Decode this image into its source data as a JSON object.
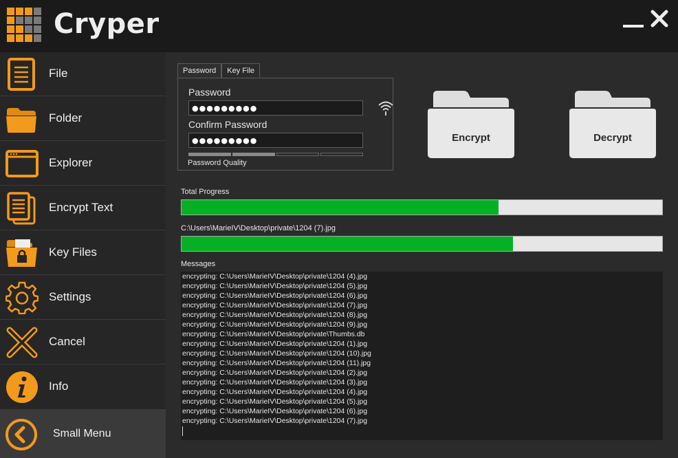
{
  "app": {
    "title": "Cryper"
  },
  "sidebar": {
    "items": [
      {
        "label": "File",
        "icon": "file-icon"
      },
      {
        "label": "Folder",
        "icon": "folder-icon"
      },
      {
        "label": "Explorer",
        "icon": "explorer-window-icon"
      },
      {
        "label": "Encrypt Text",
        "icon": "documents-icon"
      },
      {
        "label": "Key Files",
        "icon": "key-files-icon"
      },
      {
        "label": "Settings",
        "icon": "gear-icon"
      },
      {
        "label": "Cancel",
        "icon": "cancel-x-icon"
      },
      {
        "label": "Info",
        "icon": "info-icon"
      }
    ],
    "small_menu_label": "Small Menu"
  },
  "password_panel": {
    "tabs": [
      "Password",
      "Key File"
    ],
    "password_label": "Password",
    "password_value": "●●●●●●●●●",
    "confirm_label": "Confirm Password",
    "confirm_value": "●●●●●●●●●",
    "quality_label": "Password Quality",
    "quality_level": 0.5
  },
  "actions": {
    "encrypt_label": "Encrypt",
    "decrypt_label": "Decrypt"
  },
  "progress": {
    "total_label": "Total Progress",
    "total_percent": 66,
    "file_label": "C:\\Users\\MarieIV\\Desktop\\private\\1204 (7).jpg",
    "file_percent": 69
  },
  "messages": {
    "label": "Messages",
    "lines": [
      "encrypting: C:\\Users\\MarieIV\\Desktop\\private\\1204 (4).jpg",
      "encrypting: C:\\Users\\MarieIV\\Desktop\\private\\1204 (5).jpg",
      "encrypting: C:\\Users\\MarieIV\\Desktop\\private\\1204 (6).jpg",
      "encrypting: C:\\Users\\MarieIV\\Desktop\\private\\1204 (7).jpg",
      "encrypting: C:\\Users\\MarieIV\\Desktop\\private\\1204 (8).jpg",
      "encrypting: C:\\Users\\MarieIV\\Desktop\\private\\1204 (9).jpg",
      "encrypting: C:\\Users\\MarieIV\\Desktop\\private\\Thumbs.db",
      "encrypting: C:\\Users\\MarieIV\\Desktop\\private\\1204 (1).jpg",
      "encrypting: C:\\Users\\MarieIV\\Desktop\\private\\1204 (10).jpg",
      "encrypting: C:\\Users\\MarieIV\\Desktop\\private\\1204 (11).jpg",
      "encrypting: C:\\Users\\MarieIV\\Desktop\\private\\1204 (2).jpg",
      "encrypting: C:\\Users\\MarieIV\\Desktop\\private\\1204 (3).jpg",
      "encrypting: C:\\Users\\MarieIV\\Desktop\\private\\1204 (4).jpg",
      "encrypting: C:\\Users\\MarieIV\\Desktop\\private\\1204 (5).jpg",
      "encrypting: C:\\Users\\MarieIV\\Desktop\\private\\1204 (6).jpg",
      "encrypting: C:\\Users\\MarieIV\\Desktop\\private\\1204 (7).jpg"
    ]
  },
  "colors": {
    "accent": "#f29a1b",
    "progress_fill": "#06b025",
    "background": "#1a1a1a",
    "sidebar": "#262626",
    "main": "#2b2b2b"
  }
}
